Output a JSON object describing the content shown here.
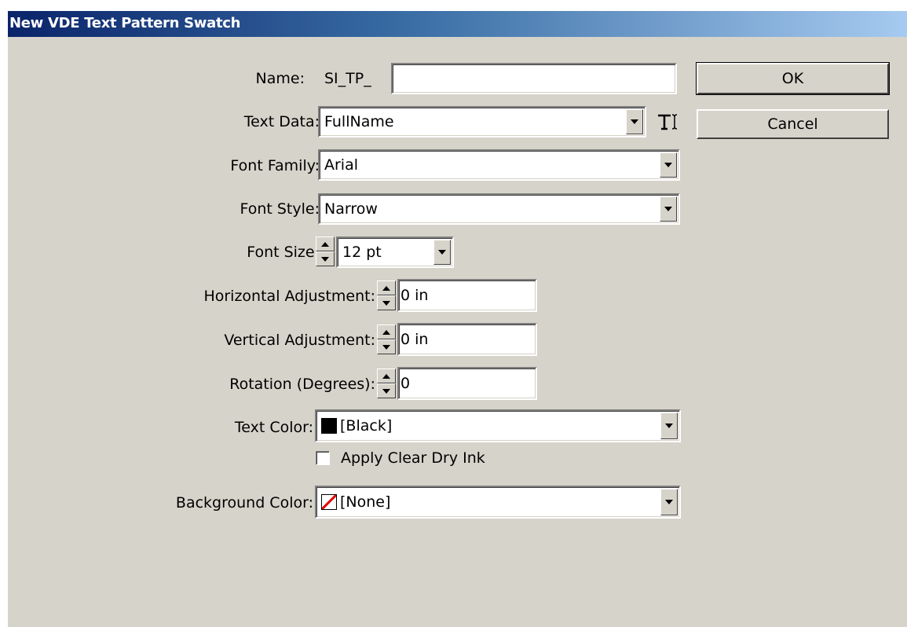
{
  "window": {
    "title": "New VDE Text Pattern Swatch"
  },
  "form": {
    "name": {
      "label": "Name:",
      "prefix": "SI_TP_",
      "value": ""
    },
    "text_data": {
      "label": "Text Data:",
      "value": "FullName",
      "icon": "text-insert-icon"
    },
    "font_family": {
      "label": "Font Family:",
      "value": "Arial"
    },
    "font_style": {
      "label": "Font Style:",
      "value": "Narrow"
    },
    "font_size": {
      "label": "Font Size:",
      "value": "12 pt"
    },
    "horizontal_adjustment": {
      "label": "Horizontal Adjustment:",
      "value": "0 in"
    },
    "vertical_adjustment": {
      "label": "Vertical Adjustment:",
      "value": "0 in"
    },
    "rotation": {
      "label": "Rotation (Degrees):",
      "value": "0"
    },
    "text_color": {
      "label": "Text Color:",
      "value": "[Black]",
      "swatch_color": "#000000"
    },
    "apply_clear_dry_ink": {
      "label": "Apply Clear Dry Ink",
      "checked": false
    },
    "background_color": {
      "label": "Background Color:",
      "value": "[None]",
      "swatch_color": "none"
    }
  },
  "buttons": {
    "ok": "OK",
    "cancel": "Cancel"
  },
  "colors": {
    "dialog_bg": "#d6d3ca",
    "titlebar_start": "#0a246a",
    "titlebar_end": "#a6caf0",
    "none_slash": "#e00000"
  }
}
